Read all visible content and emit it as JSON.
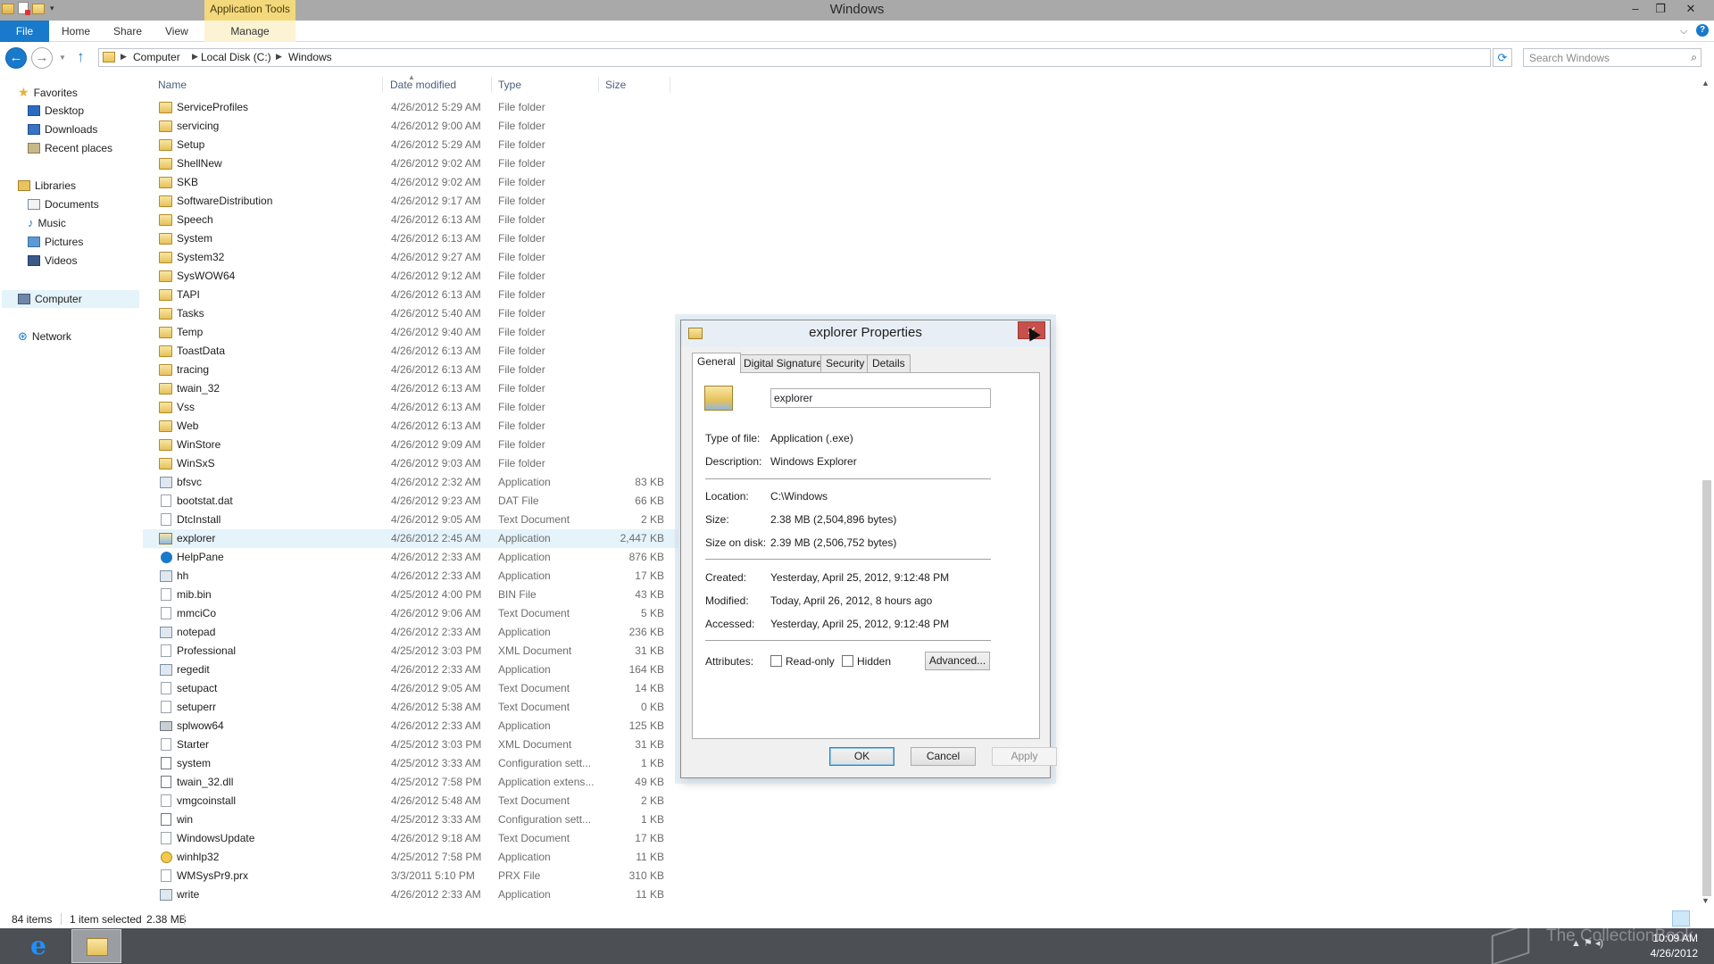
{
  "window": {
    "title": "Windows",
    "app_tools_label": "Application Tools",
    "controls": {
      "minimize": "–",
      "maximize": "❐",
      "close": "✕"
    }
  },
  "ribbon": {
    "tabs": [
      "File",
      "Home",
      "Share",
      "View",
      "Manage"
    ],
    "collapse_glyph": "⌵",
    "help_glyph": "?"
  },
  "address": {
    "breadcrumbs": [
      "Computer",
      "Local Disk (C:)",
      "Windows"
    ],
    "search_placeholder": "Search Windows"
  },
  "nav": {
    "favorites": {
      "label": "Favorites",
      "items": [
        "Desktop",
        "Downloads",
        "Recent places"
      ]
    },
    "libraries": {
      "label": "Libraries",
      "items": [
        "Documents",
        "Music",
        "Pictures",
        "Videos"
      ]
    },
    "computer": "Computer",
    "network": "Network"
  },
  "columns": {
    "name": "Name",
    "date": "Date modified",
    "type": "Type",
    "size": "Size"
  },
  "files": [
    {
      "name": "ServiceProfiles",
      "date": "4/26/2012 5:29 AM",
      "type": "File folder",
      "size": "",
      "icon": "folder"
    },
    {
      "name": "servicing",
      "date": "4/26/2012 9:00 AM",
      "type": "File folder",
      "size": "",
      "icon": "folder"
    },
    {
      "name": "Setup",
      "date": "4/26/2012 5:29 AM",
      "type": "File folder",
      "size": "",
      "icon": "folder"
    },
    {
      "name": "ShellNew",
      "date": "4/26/2012 9:02 AM",
      "type": "File folder",
      "size": "",
      "icon": "folder"
    },
    {
      "name": "SKB",
      "date": "4/26/2012 9:02 AM",
      "type": "File folder",
      "size": "",
      "icon": "folder"
    },
    {
      "name": "SoftwareDistribution",
      "date": "4/26/2012 9:17 AM",
      "type": "File folder",
      "size": "",
      "icon": "folder"
    },
    {
      "name": "Speech",
      "date": "4/26/2012 6:13 AM",
      "type": "File folder",
      "size": "",
      "icon": "folder"
    },
    {
      "name": "System",
      "date": "4/26/2012 6:13 AM",
      "type": "File folder",
      "size": "",
      "icon": "folder"
    },
    {
      "name": "System32",
      "date": "4/26/2012 9:27 AM",
      "type": "File folder",
      "size": "",
      "icon": "folder"
    },
    {
      "name": "SysWOW64",
      "date": "4/26/2012 9:12 AM",
      "type": "File folder",
      "size": "",
      "icon": "folder"
    },
    {
      "name": "TAPI",
      "date": "4/26/2012 6:13 AM",
      "type": "File folder",
      "size": "",
      "icon": "folder"
    },
    {
      "name": "Tasks",
      "date": "4/26/2012 5:40 AM",
      "type": "File folder",
      "size": "",
      "icon": "folder"
    },
    {
      "name": "Temp",
      "date": "4/26/2012 9:40 AM",
      "type": "File folder",
      "size": "",
      "icon": "folder"
    },
    {
      "name": "ToastData",
      "date": "4/26/2012 6:13 AM",
      "type": "File folder",
      "size": "",
      "icon": "folder"
    },
    {
      "name": "tracing",
      "date": "4/26/2012 6:13 AM",
      "type": "File folder",
      "size": "",
      "icon": "folder"
    },
    {
      "name": "twain_32",
      "date": "4/26/2012 6:13 AM",
      "type": "File folder",
      "size": "",
      "icon": "folder"
    },
    {
      "name": "Vss",
      "date": "4/26/2012 6:13 AM",
      "type": "File folder",
      "size": "",
      "icon": "folder"
    },
    {
      "name": "Web",
      "date": "4/26/2012 6:13 AM",
      "type": "File folder",
      "size": "",
      "icon": "folder"
    },
    {
      "name": "WinStore",
      "date": "4/26/2012 9:09 AM",
      "type": "File folder",
      "size": "",
      "icon": "folder"
    },
    {
      "name": "WinSxS",
      "date": "4/26/2012 9:03 AM",
      "type": "File folder",
      "size": "",
      "icon": "folder"
    },
    {
      "name": "bfsvc",
      "date": "4/26/2012 2:32 AM",
      "type": "Application",
      "size": "83 KB",
      "icon": "app"
    },
    {
      "name": "bootstat.dat",
      "date": "4/26/2012 9:23 AM",
      "type": "DAT File",
      "size": "66 KB",
      "icon": "file"
    },
    {
      "name": "DtcInstall",
      "date": "4/26/2012 9:05 AM",
      "type": "Text Document",
      "size": "2 KB",
      "icon": "file"
    },
    {
      "name": "explorer",
      "date": "4/26/2012 2:45 AM",
      "type": "Application",
      "size": "2,447 KB",
      "icon": "explorer",
      "selected": true
    },
    {
      "name": "HelpPane",
      "date": "4/26/2012 2:33 AM",
      "type": "Application",
      "size": "876 KB",
      "icon": "help"
    },
    {
      "name": "hh",
      "date": "4/26/2012 2:33 AM",
      "type": "Application",
      "size": "17 KB",
      "icon": "app"
    },
    {
      "name": "mib.bin",
      "date": "4/25/2012 4:00 PM",
      "type": "BIN File",
      "size": "43 KB",
      "icon": "file"
    },
    {
      "name": "mmciCo",
      "date": "4/26/2012 9:06 AM",
      "type": "Text Document",
      "size": "5 KB",
      "icon": "file"
    },
    {
      "name": "notepad",
      "date": "4/26/2012 2:33 AM",
      "type": "Application",
      "size": "236 KB",
      "icon": "app"
    },
    {
      "name": "Professional",
      "date": "4/25/2012 3:03 PM",
      "type": "XML Document",
      "size": "31 KB",
      "icon": "file"
    },
    {
      "name": "regedit",
      "date": "4/26/2012 2:33 AM",
      "type": "Application",
      "size": "164 KB",
      "icon": "app"
    },
    {
      "name": "setupact",
      "date": "4/26/2012 9:05 AM",
      "type": "Text Document",
      "size": "14 KB",
      "icon": "file"
    },
    {
      "name": "setuperr",
      "date": "4/26/2012 5:38 AM",
      "type": "Text Document",
      "size": "0 KB",
      "icon": "file"
    },
    {
      "name": "splwow64",
      "date": "4/26/2012 2:33 AM",
      "type": "Application",
      "size": "125 KB",
      "icon": "printer"
    },
    {
      "name": "Starter",
      "date": "4/25/2012 3:03 PM",
      "type": "XML Document",
      "size": "31 KB",
      "icon": "file"
    },
    {
      "name": "system",
      "date": "4/25/2012 3:33 AM",
      "type": "Configuration sett...",
      "size": "1 KB",
      "icon": "gear"
    },
    {
      "name": "twain_32.dll",
      "date": "4/25/2012 7:58 PM",
      "type": "Application extens...",
      "size": "49 KB",
      "icon": "gear"
    },
    {
      "name": "vmgcoinstall",
      "date": "4/26/2012 5:48 AM",
      "type": "Text Document",
      "size": "2 KB",
      "icon": "file"
    },
    {
      "name": "win",
      "date": "4/25/2012 3:33 AM",
      "type": "Configuration sett...",
      "size": "1 KB",
      "icon": "gear"
    },
    {
      "name": "WindowsUpdate",
      "date": "4/26/2012 9:18 AM",
      "type": "Text Document",
      "size": "17 KB",
      "icon": "file"
    },
    {
      "name": "winhlp32",
      "date": "4/25/2012 7:58 PM",
      "type": "Application",
      "size": "11 KB",
      "icon": "helpyellow"
    },
    {
      "name": "WMSysPr9.prx",
      "date": "3/3/2011 5:10 PM",
      "type": "PRX File",
      "size": "310 KB",
      "icon": "file"
    },
    {
      "name": "write",
      "date": "4/26/2012 2:33 AM",
      "type": "Application",
      "size": "11 KB",
      "icon": "app"
    }
  ],
  "status": {
    "count": "84 items",
    "selected": "1 item selected",
    "size": "2.38 MB"
  },
  "taskbar": {
    "clock_time": "10:09 AM",
    "clock_date": "4/26/2012",
    "watermark": "The CollectionBook"
  },
  "dialog": {
    "title": "explorer Properties",
    "close_glyph": "✕",
    "tabs": [
      "General",
      "Digital Signatures",
      "Security",
      "Details"
    ],
    "file_name": "explorer",
    "props": {
      "type_label": "Type of file:",
      "type_value": "Application (.exe)",
      "desc_label": "Description:",
      "desc_value": "Windows Explorer",
      "loc_label": "Location:",
      "loc_value": "C:\\Windows",
      "size_label": "Size:",
      "size_value": "2.38 MB (2,504,896 bytes)",
      "disk_label": "Size on disk:",
      "disk_value": "2.39 MB (2,506,752 bytes)",
      "created_label": "Created:",
      "created_value": "Yesterday, April 25, 2012, 9:12:48 PM",
      "modified_label": "Modified:",
      "modified_value": "Today, April 26, 2012, 8 hours ago",
      "accessed_label": "Accessed:",
      "accessed_value": "Yesterday, April 25, 2012, 9:12:48 PM",
      "attr_label": "Attributes:",
      "readonly_label": "Read-only",
      "hidden_label": "Hidden",
      "advanced_label": "Advanced..."
    },
    "buttons": {
      "ok": "OK",
      "cancel": "Cancel",
      "apply": "Apply"
    }
  }
}
